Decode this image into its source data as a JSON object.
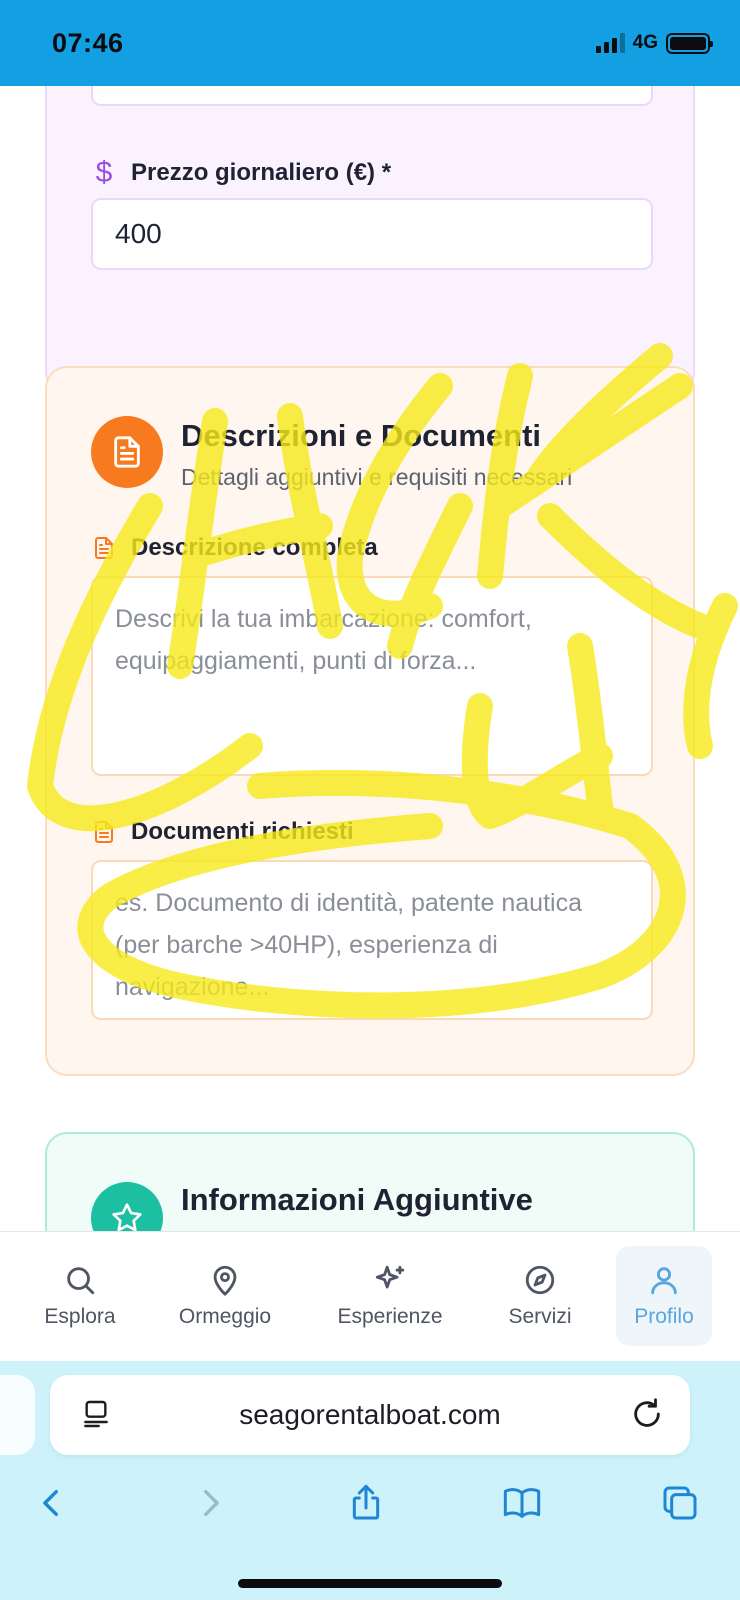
{
  "status_bar": {
    "time": "07:46",
    "network": "4G"
  },
  "pricing_section": {
    "daily_price_label": "Prezzo giornaliero (€) *",
    "daily_price_value": "400"
  },
  "descriptions_section": {
    "title": "Descrizioni e Documenti",
    "subtitle": "Dettagli aggiuntivi e requisiti necessari",
    "full_description_label": "Descrizione completa",
    "full_description_placeholder": "Descrivi la tua imbarcazione: comfort, equipaggiamenti, punti di forza...",
    "required_documents_label": "Documenti richiesti",
    "required_documents_placeholder": "es. Documento di identità, patente nautica (per barche >40HP), esperienza di navigazione..."
  },
  "additional_info_section": {
    "title": "Informazioni Aggiuntive"
  },
  "tab_bar": {
    "tabs": [
      {
        "label": "Esplora",
        "icon": "search-icon"
      },
      {
        "label": "Ormeggio",
        "icon": "map-pin-icon"
      },
      {
        "label": "Esperienze",
        "icon": "sparkles-icon"
      },
      {
        "label": "Servizi",
        "icon": "compass-icon"
      },
      {
        "label": "Profilo",
        "icon": "user-icon"
      }
    ],
    "active_tab": "Profilo"
  },
  "browser": {
    "url": "seagorentalboat.com"
  },
  "colors": {
    "status_bar": "#13a0e2",
    "purple_accent": "#9b4de0",
    "orange_accent": "#f77b1e",
    "teal_accent": "#1dbfa2",
    "active_tab": "#5aa6dc",
    "highlighter": "#f7ea1a"
  }
}
